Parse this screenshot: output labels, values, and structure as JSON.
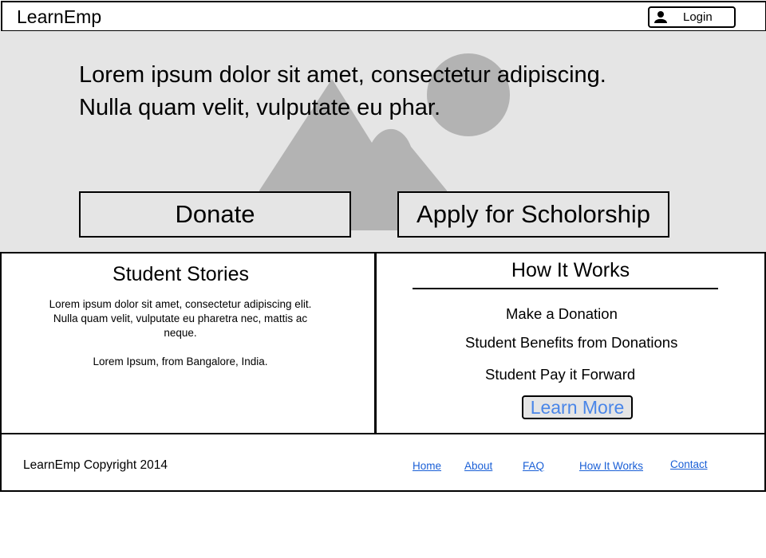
{
  "header": {
    "brand": "LearnEmp",
    "login_label": "Login",
    "login_icon": "user-icon"
  },
  "hero": {
    "headline_line1": "Lorem ipsum dolor sit amet, consectetur adipiscing.",
    "headline_line2": "Nulla quam velit, vulputate eu phar.",
    "image_placeholder_icon": "image-placeholder-icon",
    "donate_label": "Donate",
    "scholarship_label": "Apply for Scholorship"
  },
  "stories": {
    "title": "Student Stories",
    "text": "Lorem ipsum dolor sit amet, consectetur adipiscing elit. Nulla quam velit, vulputate eu pharetra nec, mattis ac neque.",
    "attribution": "Lorem Ipsum, from Bangalore, India."
  },
  "how_it_works": {
    "title": "How It Works",
    "steps": [
      "Make a Donation",
      "Student Benefits from Donations",
      "Student Pay it Forward"
    ],
    "learn_more_label": "Learn More"
  },
  "footer": {
    "copyright": "LearnEmp Copyright 2014",
    "links": [
      "Home",
      "About",
      "FAQ",
      "How It Works",
      "Contact"
    ]
  },
  "colors": {
    "hero_background": "#e5e5e5",
    "placeholder_gray": "#b3b3b3",
    "learn_more_text": "#4a86e8",
    "link": "#1a5fd6"
  }
}
